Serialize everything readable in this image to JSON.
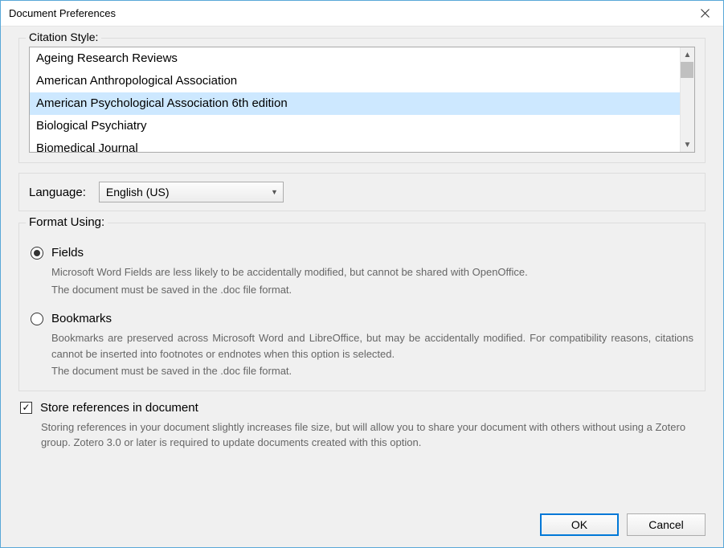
{
  "window": {
    "title": "Document Preferences"
  },
  "citation": {
    "label": "Citation Style:",
    "items": [
      "Ageing Research Reviews",
      "American Anthropological Association",
      "American Psychological Association 6th edition",
      "Biological Psychiatry",
      "Biomedical Journal"
    ],
    "selected_index": 2
  },
  "language": {
    "label": "Language:",
    "value": "English (US)"
  },
  "format": {
    "label": "Format Using:",
    "fields": {
      "label": "Fields",
      "desc1": "Microsoft Word Fields are less likely to be accidentally modified, but cannot be shared with OpenOffice.",
      "desc2": "The document must be saved in the .doc file format.",
      "checked": true
    },
    "bookmarks": {
      "label": "Bookmarks",
      "desc1": "Bookmarks are preserved across Microsoft Word and LibreOffice, but may be accidentally modified. For compatibility reasons, citations cannot be inserted into footnotes or endnotes when this option is selected.",
      "desc2": "The document must be saved in the .doc file format.",
      "checked": false
    }
  },
  "store": {
    "label": "Store references in document",
    "desc": "Storing references in your document slightly increases file size, but will allow you to share your document with others without using a Zotero group. Zotero 3.0 or later is required to update documents created with this option.",
    "checked": true
  },
  "buttons": {
    "ok": "OK",
    "cancel": "Cancel"
  }
}
